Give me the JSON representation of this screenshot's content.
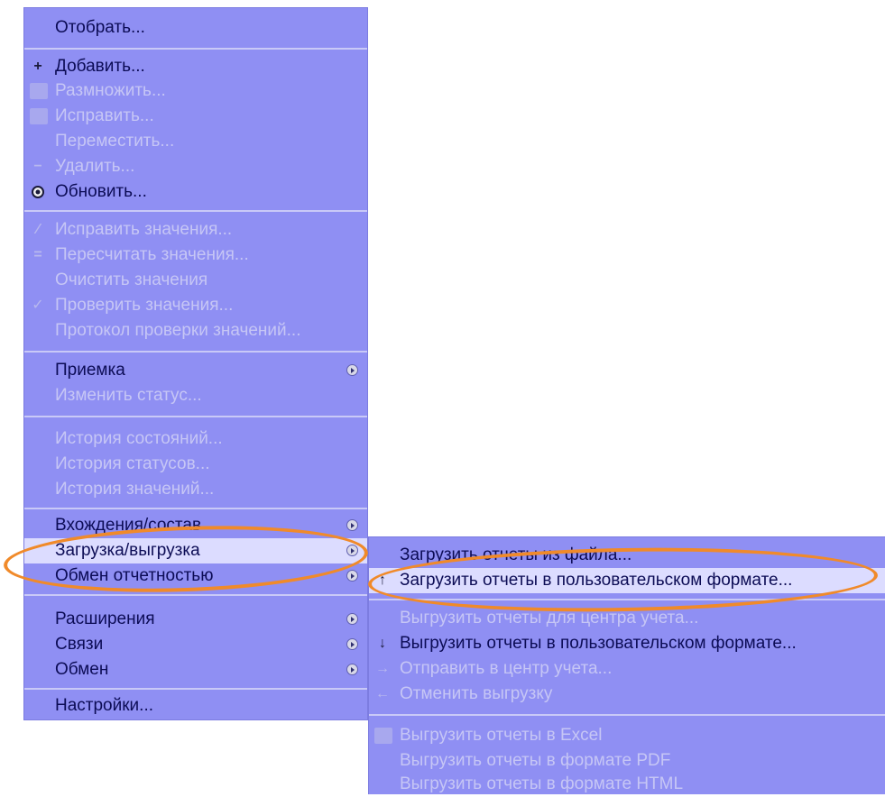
{
  "main_menu": {
    "items": [
      {
        "label": "Отобрать...",
        "enabled": true,
        "icon": ""
      },
      {
        "label": "Добавить...",
        "enabled": true,
        "icon": "plus-icon"
      },
      {
        "label": "Размножить...",
        "enabled": false,
        "icon": "copy-icon"
      },
      {
        "label": "Исправить...",
        "enabled": false,
        "icon": "edit-icon"
      },
      {
        "label": "Переместить...",
        "enabled": false,
        "icon": ""
      },
      {
        "label": "Удалить...",
        "enabled": false,
        "icon": "minus-icon"
      },
      {
        "label": "Обновить...",
        "enabled": true,
        "icon": "refresh-icon"
      },
      {
        "label": "Исправить значения...",
        "enabled": false,
        "icon": "pencil-icon"
      },
      {
        "label": "Пересчитать значения...",
        "enabled": false,
        "icon": "equals-icon"
      },
      {
        "label": "Очистить значения",
        "enabled": false,
        "icon": ""
      },
      {
        "label": "Проверить значения...",
        "enabled": false,
        "icon": "check-icon"
      },
      {
        "label": "Протокол проверки значений...",
        "enabled": false,
        "icon": ""
      },
      {
        "label": "Приемка",
        "enabled": true,
        "icon": "",
        "submenu": true
      },
      {
        "label": "Изменить статус...",
        "enabled": false,
        "icon": ""
      },
      {
        "label": "История состояний...",
        "enabled": false,
        "icon": ""
      },
      {
        "label": "История статусов...",
        "enabled": false,
        "icon": ""
      },
      {
        "label": "История значений...",
        "enabled": false,
        "icon": ""
      },
      {
        "label": "Вхождения/состав",
        "enabled": true,
        "icon": "",
        "submenu": true
      },
      {
        "label": "Загрузка/выгрузка",
        "enabled": true,
        "icon": "",
        "submenu": true,
        "highlighted": true
      },
      {
        "label": "Обмен отчетностью",
        "enabled": true,
        "icon": "",
        "submenu": true
      },
      {
        "label": "Расширения",
        "enabled": true,
        "icon": "",
        "submenu": true
      },
      {
        "label": "Связи",
        "enabled": true,
        "icon": "",
        "submenu": true
      },
      {
        "label": "Обмен",
        "enabled": true,
        "icon": "",
        "submenu": true
      },
      {
        "label": "Настройки...",
        "enabled": true,
        "icon": ""
      }
    ]
  },
  "sub_menu": {
    "items": [
      {
        "label": "Загрузить отчеты из файла...",
        "enabled": true,
        "icon": ""
      },
      {
        "label": "Загрузить отчеты в пользовательском формате...",
        "enabled": true,
        "icon": "upload-icon",
        "highlighted": true
      },
      {
        "label": "Выгрузить отчеты для центра учета...",
        "enabled": false,
        "icon": ""
      },
      {
        "label": "Выгрузить отчеты в пользовательском формате...",
        "enabled": true,
        "icon": "download-icon"
      },
      {
        "label": "Отправить в центр учета...",
        "enabled": false,
        "icon": "arrow-right-icon"
      },
      {
        "label": "Отменить выгрузку",
        "enabled": false,
        "icon": "arrow-left-icon"
      },
      {
        "label": "Выгрузить отчеты в Excel",
        "enabled": false,
        "icon": "excel-icon"
      },
      {
        "label": "Выгрузить отчеты в формате PDF",
        "enabled": false,
        "icon": ""
      },
      {
        "label": "Выгрузить отчеты в формате HTML",
        "enabled": false,
        "icon": ""
      }
    ]
  },
  "colors": {
    "menu_bg": "#8f8ff3",
    "text_enabled": "#0c0c55",
    "text_disabled": "#c6c6f5",
    "highlight_bg": "#dcdcff",
    "annotation": "#f08a2a"
  }
}
